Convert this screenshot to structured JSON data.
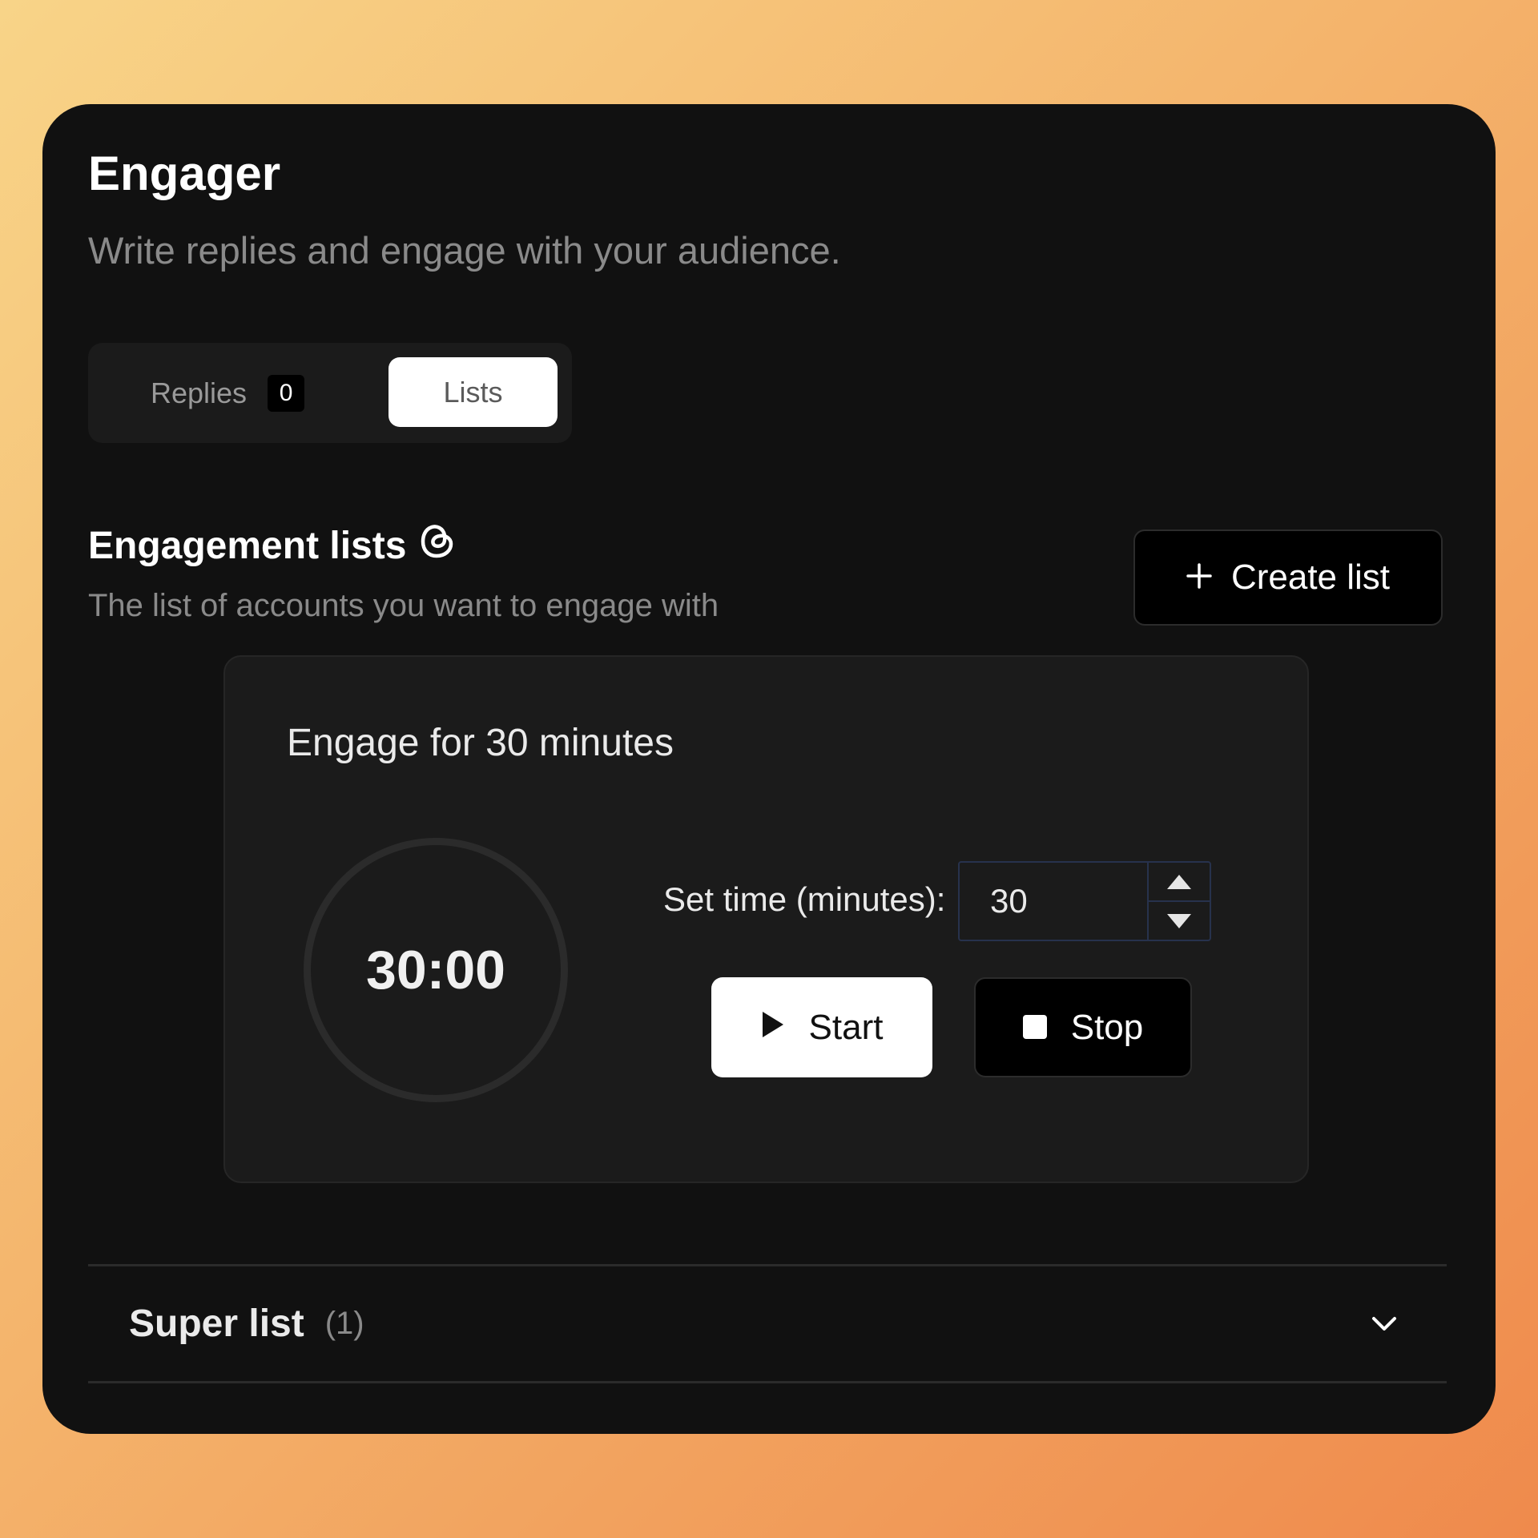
{
  "header": {
    "title": "Engager",
    "subtitle": "Write replies and engage with your audience."
  },
  "tabs": {
    "replies_label": "Replies",
    "replies_count": "0",
    "lists_label": "Lists",
    "active": "Lists"
  },
  "engagement": {
    "title": "Engagement lists",
    "title_icon": "threads-icon",
    "description": "The list of accounts you want to engage with",
    "create_button_label": "Create list",
    "create_button_icon": "plus-icon"
  },
  "timer": {
    "heading": "Engage for 30 minutes",
    "display": "30:00",
    "set_time_label": "Set time (minutes):",
    "minutes_value": "30",
    "start_label": "Start",
    "start_icon": "play-icon",
    "stop_label": "Stop",
    "stop_icon": "stop-icon"
  },
  "lists": [
    {
      "name": "Super list",
      "count": "(1)",
      "icon": "chevron-down-icon"
    }
  ],
  "colors": {
    "card_background": "#111111",
    "panel_background": "#1b1b1b",
    "input_border": "#27324d",
    "primary_text": "#ffffff",
    "muted_text": "#8a8a8a"
  }
}
